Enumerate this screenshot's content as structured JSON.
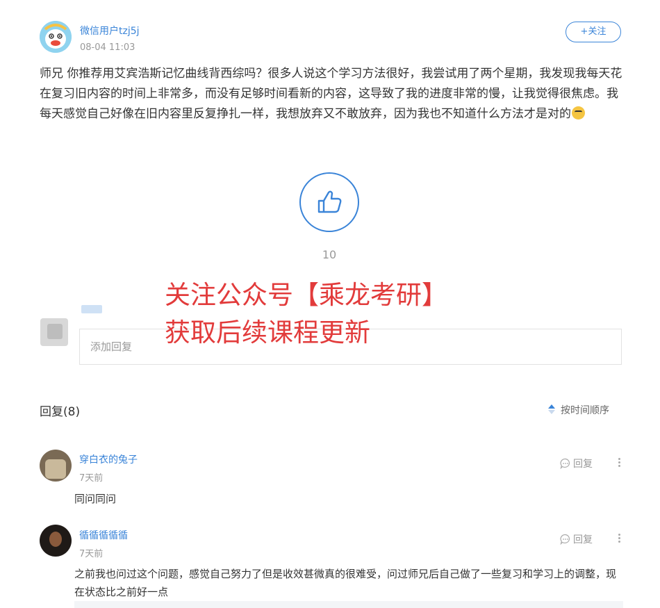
{
  "post": {
    "author": "微信用户tzj5j",
    "time": "08-04 11:03",
    "follow_label": "+关注",
    "content": "师兄 你推荐用艾宾浩斯记忆曲线背西综吗？很多人说这个学习方法很好，我尝试用了两个星期，我发现我每天花在复习旧内容的时间上非常多，而没有足够时间看新的内容，这导致了我的进度非常的慢，让我觉得很焦虑。我每天感觉自己好像在旧内容里反复挣扎一样，我想放弃又不敢放弃，因为我也不知道什么方法才是对的",
    "emoji_icon": "crying-face-icon",
    "likes": "10"
  },
  "watermark": {
    "line1": "关注公众号【乘龙考研】",
    "line2": "获取后续课程更新"
  },
  "composer": {
    "placeholder": "添加回复"
  },
  "replies": {
    "title": "回复(8)",
    "sort_label": "按时间顺序",
    "reply_label": "回复",
    "items": [
      {
        "name": "穿白衣的兔子",
        "time": "7天前",
        "text": "同问同问"
      },
      {
        "name": "循循循循循",
        "time": "7天前",
        "text": "之前我也问过这个问题，感觉自己努力了但是收效甚微真的很难受，问过师兄后自己做了一些复习和学习上的调整，现在状态比之前好一点"
      }
    ]
  },
  "colors": {
    "accent": "#3a84d8",
    "watermark": "#e23b3b",
    "muted": "#999999"
  }
}
